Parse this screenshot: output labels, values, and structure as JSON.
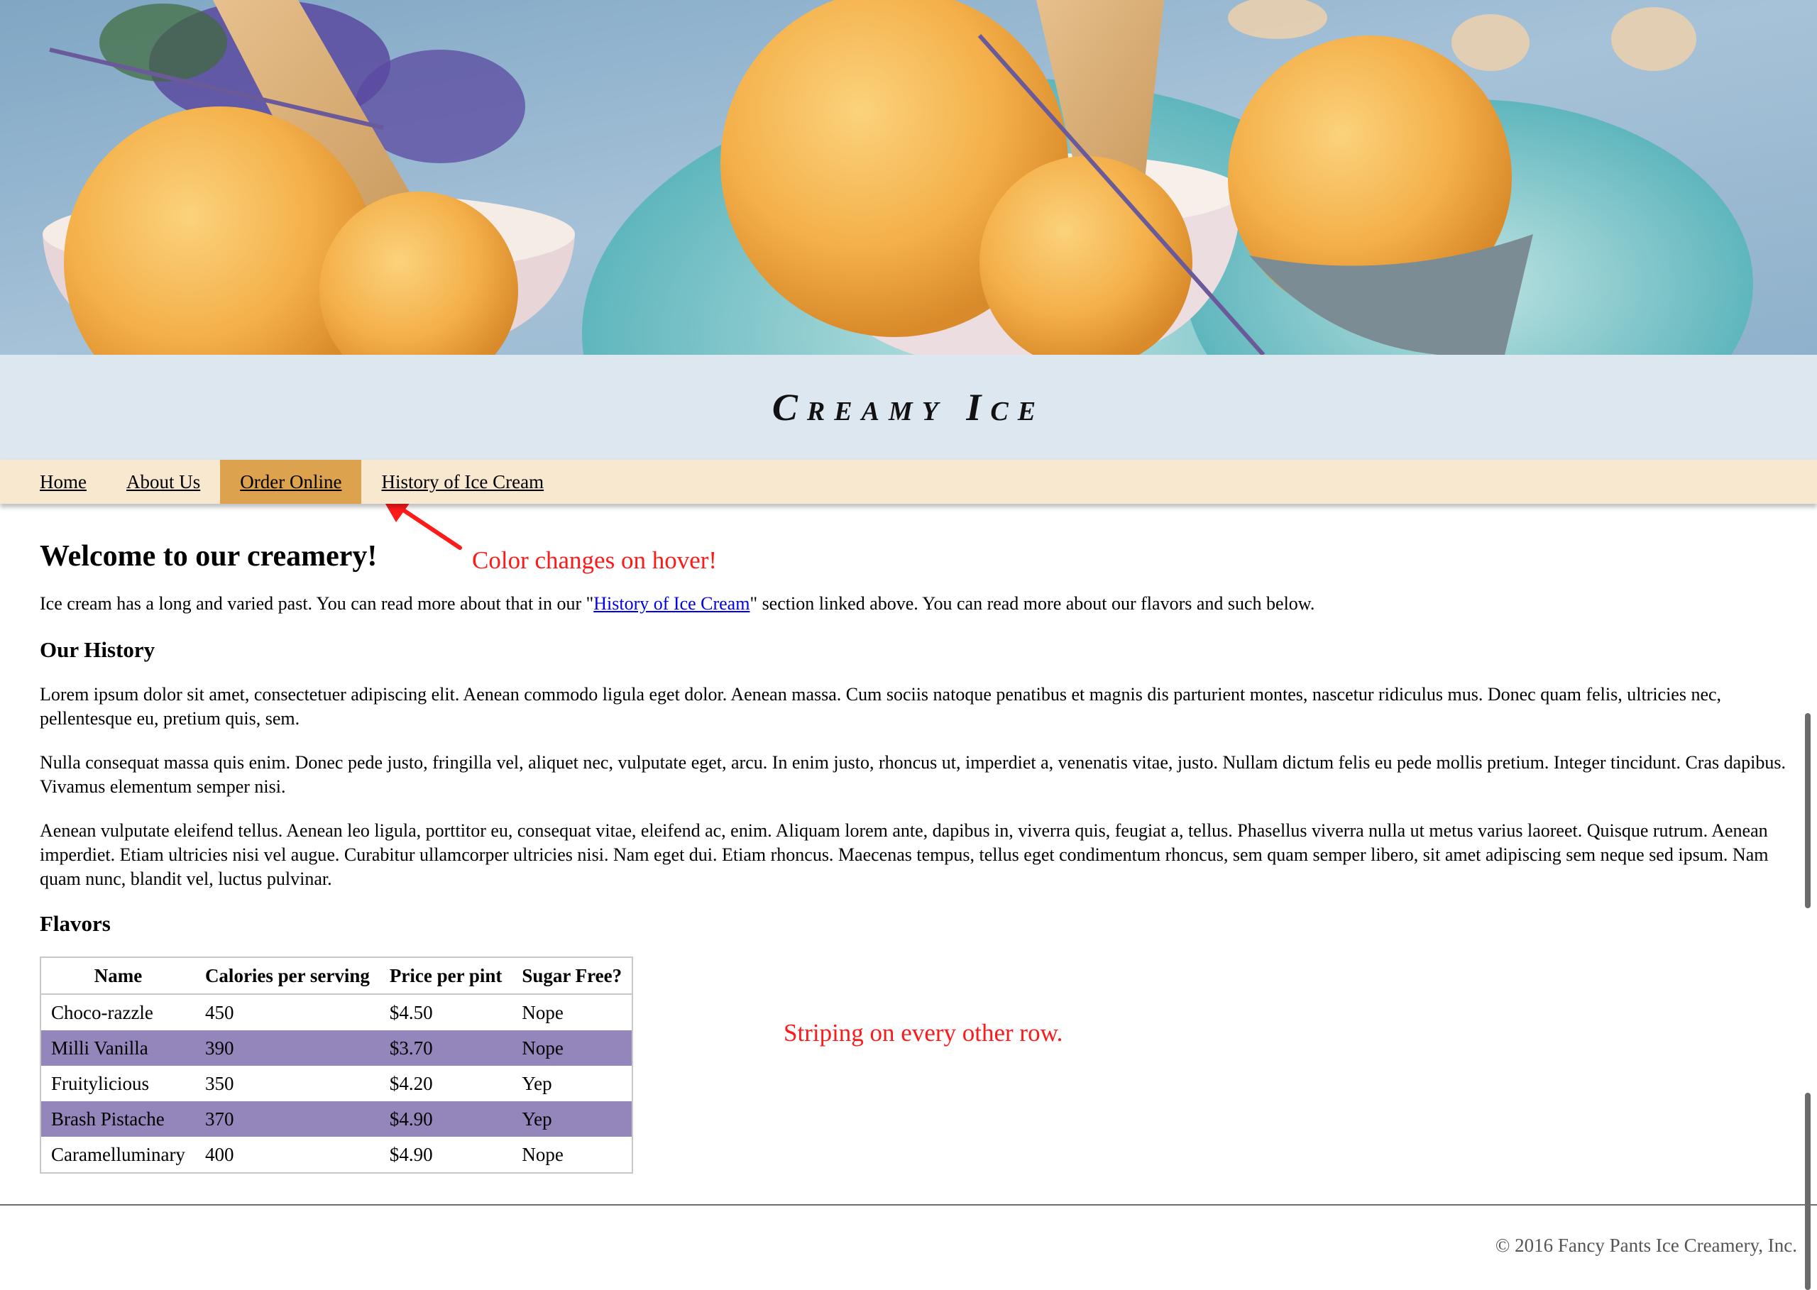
{
  "site": {
    "title": "Creamy Ice"
  },
  "nav": {
    "items": [
      {
        "label": "Home"
      },
      {
        "label": "About Us"
      },
      {
        "label": "Order Online"
      },
      {
        "label": "History of Ice Cream"
      }
    ]
  },
  "annotations": {
    "hover_note": "Color changes on hover!",
    "striping_note": "Striping on every other row."
  },
  "main": {
    "welcome_heading": "Welcome to our creamery!",
    "intro_before": "Ice cream has a long and varied past. You can read more about that in our \"",
    "intro_link": "History of Ice Cream",
    "intro_after": "\" section linked above. You can read more about our flavors and such below.",
    "history_heading": "Our History",
    "history_paragraphs": [
      "Lorem ipsum dolor sit amet, consectetuer adipiscing elit. Aenean commodo ligula eget dolor. Aenean massa. Cum sociis natoque penatibus et magnis dis parturient montes, nascetur ridiculus mus. Donec quam felis, ultricies nec, pellentesque eu, pretium quis, sem.",
      "Nulla consequat massa quis enim. Donec pede justo, fringilla vel, aliquet nec, vulputate eget, arcu. In enim justo, rhoncus ut, imperdiet a, venenatis vitae, justo. Nullam dictum felis eu pede mollis pretium. Integer tincidunt. Cras dapibus. Vivamus elementum semper nisi.",
      "Aenean vulputate eleifend tellus. Aenean leo ligula, porttitor eu, consequat vitae, eleifend ac, enim. Aliquam lorem ante, dapibus in, viverra quis, feugiat a, tellus. Phasellus viverra nulla ut metus varius laoreet. Quisque rutrum. Aenean imperdiet. Etiam ultricies nisi vel augue. Curabitur ullamcorper ultricies nisi. Nam eget dui. Etiam rhoncus. Maecenas tempus, tellus eget condimentum rhoncus, sem quam semper libero, sit amet adipiscing sem neque sed ipsum. Nam quam nunc, blandit vel, luctus pulvinar."
    ],
    "flavors_heading": "Flavors"
  },
  "table": {
    "headers": [
      "Name",
      "Calories per serving",
      "Price per pint",
      "Sugar Free?"
    ],
    "rows": [
      [
        "Choco-razzle",
        "450",
        "$4.50",
        "Nope"
      ],
      [
        "Milli Vanilla",
        "390",
        "$3.70",
        "Nope"
      ],
      [
        "Fruitylicious",
        "350",
        "$4.20",
        "Yep"
      ],
      [
        "Brash Pistache",
        "370",
        "$4.90",
        "Yep"
      ],
      [
        "Caramelluminary",
        "400",
        "$4.90",
        "Nope"
      ]
    ],
    "stripe_color": "#9485bb"
  },
  "footer": {
    "copyright": "© 2016 Fancy Pants Ice Creamery, Inc."
  },
  "colors": {
    "title_band": "#dde7f0",
    "nav_bg": "#f8e8cf",
    "nav_hover": "#dda24e",
    "annotation": "#ff1a1a",
    "link": "#0000ee"
  }
}
